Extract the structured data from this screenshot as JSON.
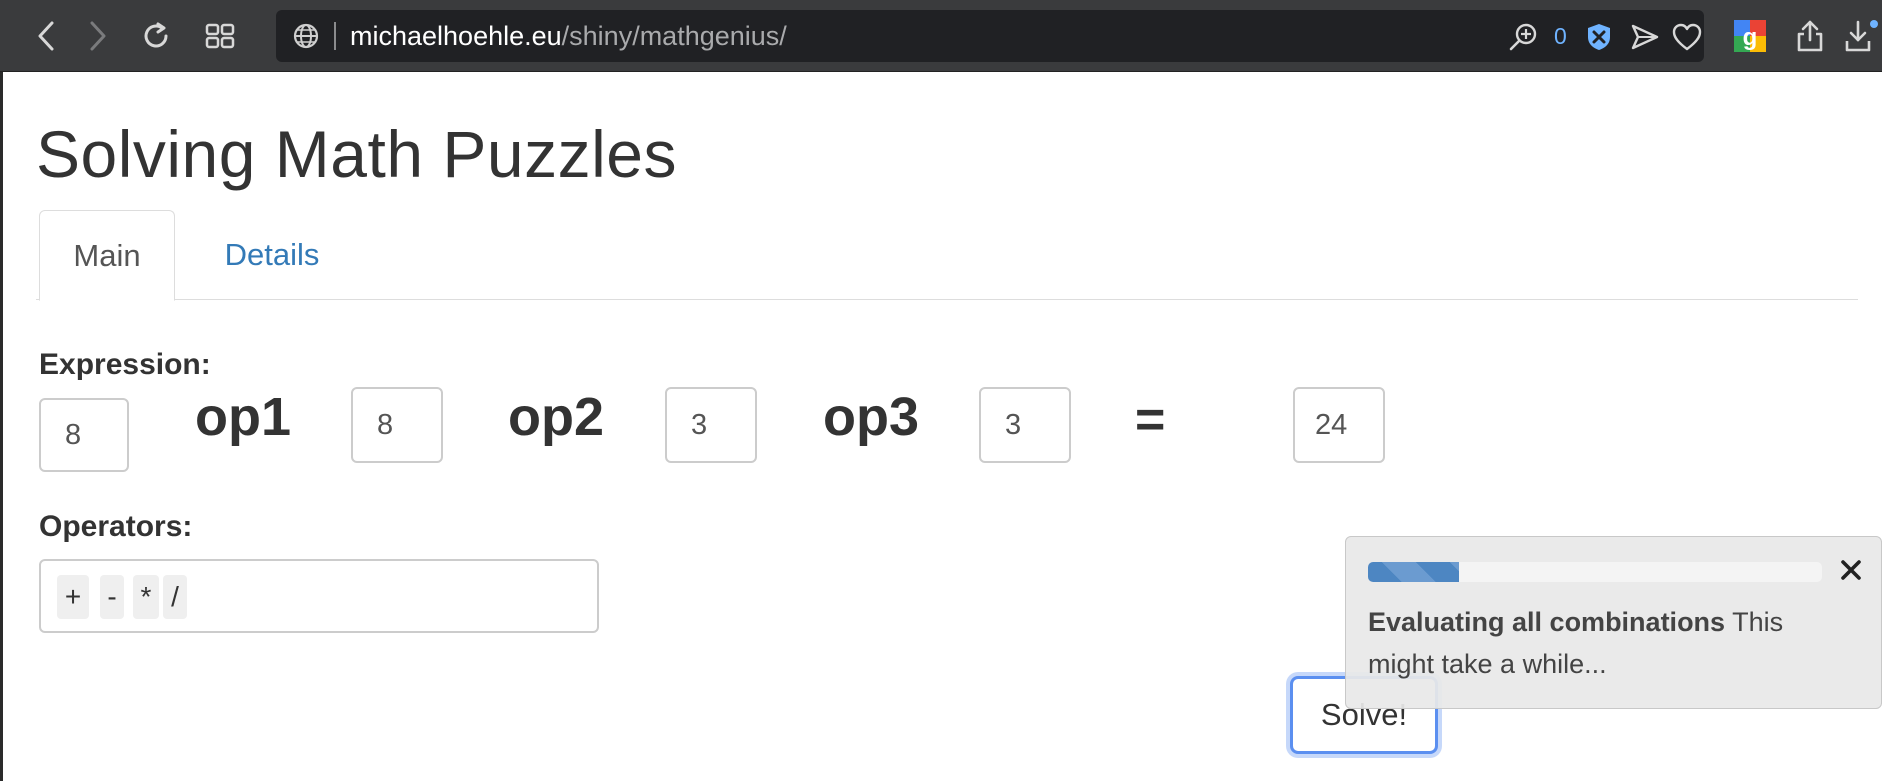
{
  "browser": {
    "url_host": "michaelhoehle.eu",
    "url_path": "/shiny/mathgenius/",
    "tracker_count": "0",
    "icons": {
      "back": "chevron-left-icon",
      "forward": "chevron-right-icon",
      "reload": "reload-icon",
      "tabs": "tab-overview-icon",
      "site": "globe-icon",
      "zoom": "zoom-in-icon",
      "shield": "shield-icon",
      "send": "send-icon",
      "favorite": "heart-icon",
      "extension": "google-extension-icon",
      "share": "share-icon",
      "download": "download-icon"
    }
  },
  "page": {
    "title": "Solving Math Puzzles",
    "tabs": [
      {
        "label": "Main",
        "active": true
      },
      {
        "label": "Details",
        "active": false
      }
    ],
    "expression": {
      "label": "Expression:",
      "values": [
        "8",
        "8",
        "3",
        "3"
      ],
      "operators": [
        "op1",
        "op2",
        "op3"
      ],
      "equals": "=",
      "result": "24"
    },
    "operators_field": {
      "label": "Operators:",
      "selected": [
        "+",
        "-",
        "*",
        "/"
      ]
    },
    "solve_label": "Solve!"
  },
  "notification": {
    "progress": 0.2,
    "title": "Evaluating all combinations",
    "message": "This might take a while...",
    "close_icon": "close-icon"
  },
  "colors": {
    "toolbar_bg": "#3a3b3d",
    "link": "#337ab7",
    "progress": "#4d86c2",
    "focus": "#5b8ff0"
  }
}
